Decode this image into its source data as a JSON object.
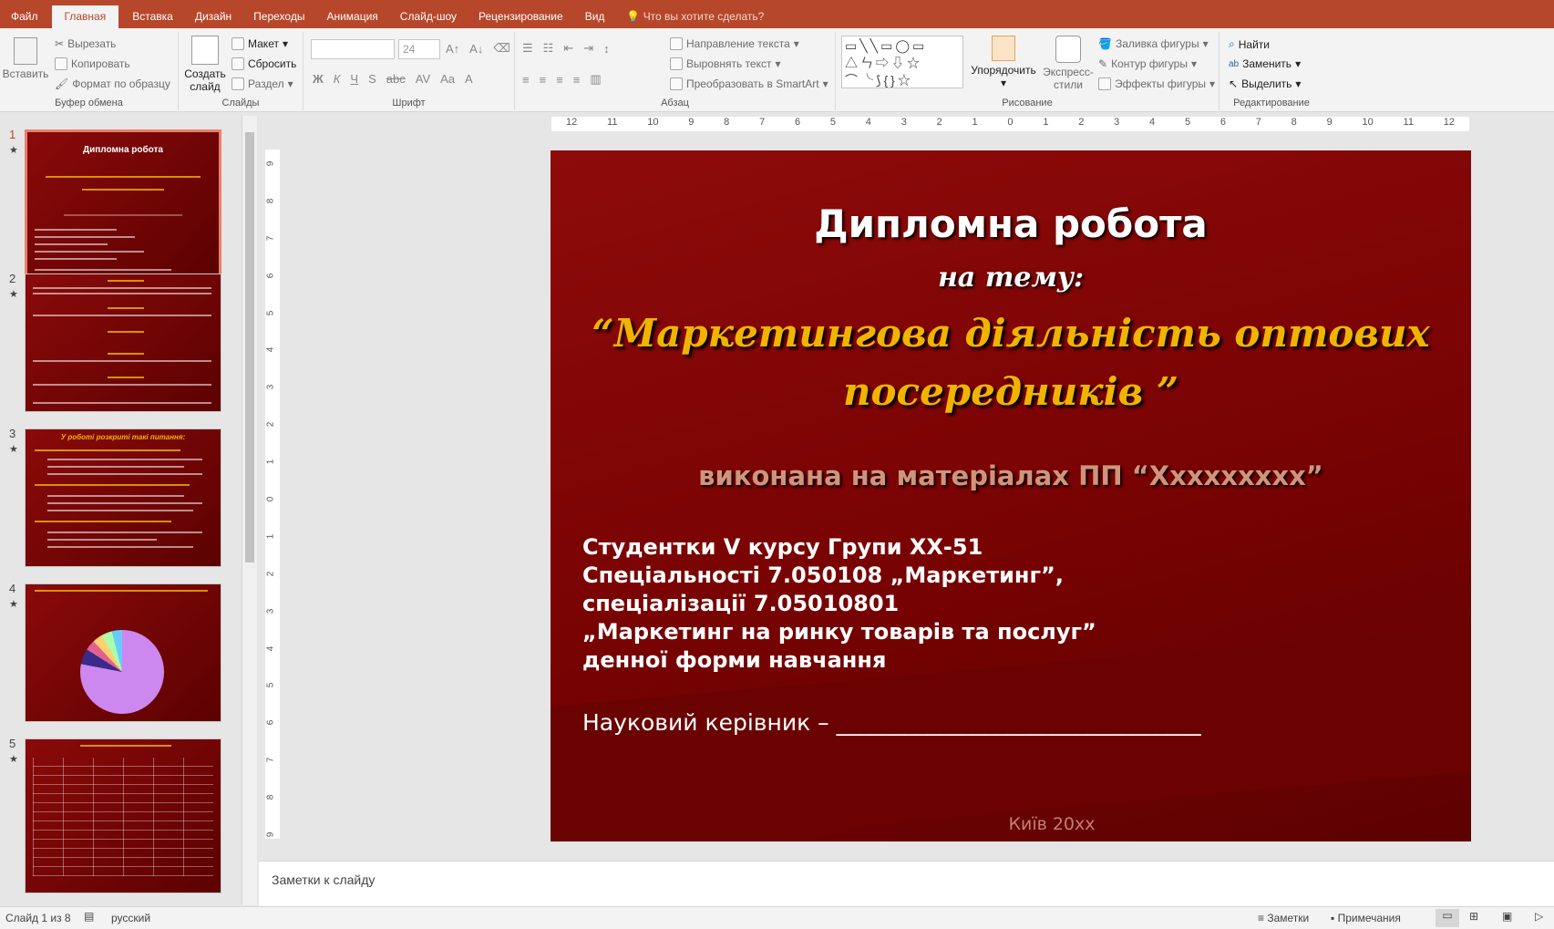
{
  "menu": {
    "tabs": [
      "Файл",
      "Главная",
      "Вставка",
      "Дизайн",
      "Переходы",
      "Анимация",
      "Слайд-шоу",
      "Рецензирование",
      "Вид"
    ],
    "tell_me": "Что вы хотите сделать?"
  },
  "ribbon": {
    "clipboard": {
      "label": "Буфер обмена",
      "paste": "Вставить",
      "cut": "Вырезать",
      "copy": "Копировать",
      "format_painter": "Формат по образцу"
    },
    "slides": {
      "label": "Слайды",
      "new_slide": "Создать слайд",
      "layout": "Макет",
      "reset": "Сбросить",
      "section": "Раздел"
    },
    "font": {
      "label": "Шрифт",
      "font_name": "",
      "font_size": "24"
    },
    "paragraph": {
      "label": "Абзац",
      "text_direction": "Направление текста",
      "align_text": "Выровнять текст",
      "smartart": "Преобразовать в SmartArt"
    },
    "drawing": {
      "label": "Рисование",
      "arrange": "Упорядочить",
      "quick_styles": "Экспресс-стили",
      "fill": "Заливка фигуры",
      "outline": "Контур фигуры",
      "effects": "Эффекты фигуры"
    },
    "editing": {
      "label": "Редактирование",
      "find": "Найти",
      "replace": "Заменить",
      "select": "Выделить"
    }
  },
  "thumbnails": [
    {
      "num": "1",
      "title": "Дипломна робота",
      "selected": true
    },
    {
      "num": "2",
      "title": "",
      "selected": false
    },
    {
      "num": "3",
      "title": "У роботі розкриті такі питання:",
      "selected": false
    },
    {
      "num": "4",
      "title": "",
      "selected": false
    },
    {
      "num": "5",
      "title": "",
      "selected": false
    }
  ],
  "ruler": {
    "h": [
      "12",
      "11",
      "10",
      "9",
      "8",
      "7",
      "6",
      "5",
      "4",
      "3",
      "2",
      "1",
      "0",
      "1",
      "2",
      "3",
      "4",
      "5",
      "6",
      "7",
      "8",
      "9",
      "10",
      "11",
      "12"
    ],
    "v": [
      "9",
      "8",
      "7",
      "6",
      "5",
      "4",
      "3",
      "2",
      "1",
      "0",
      "1",
      "2",
      "3",
      "4",
      "5",
      "6",
      "7",
      "8",
      "9"
    ]
  },
  "slide": {
    "title": "Дипломна робота",
    "subtitle": "на тему:",
    "topic_line1": "“Маркетингова діяльність оптових",
    "topic_line2": "посередників ”",
    "based_on": "виконана на матеріалах ПП “Ххххххххх”",
    "student_lines": [
      "Студентки V курсу Групи ХХ-51",
      "Спеціальності 7.050108 „Маркетинг”,",
      "спеціалізації 7.05010801",
      "„Маркетинг на ринку товарів та послуг”",
      "денної форми навчання"
    ],
    "supervisor": "Науковий керівник – ________________________________",
    "city_year": "Київ 20хх",
    "colors": {
      "title": "#ffffff",
      "topic": "#f0b400",
      "based_on": "#d0937c",
      "footer": "#c0806e"
    }
  },
  "notes": {
    "placeholder": "Заметки к слайду"
  },
  "status": {
    "slide_info": "Слайд 1 из 8",
    "language": "русский",
    "notes": "Заметки",
    "comments": "Примечания"
  }
}
